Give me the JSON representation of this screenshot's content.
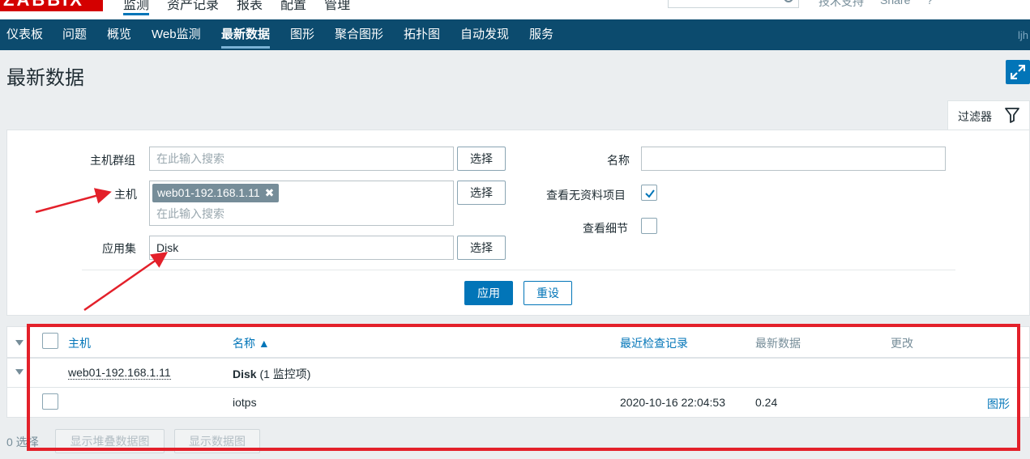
{
  "app": {
    "logo": "ZABBIX"
  },
  "top_nav": [
    "监测",
    "资产记录",
    "报表",
    "配置",
    "管理"
  ],
  "top_right": {
    "support": "技术支持",
    "share": "Share",
    "help": "?"
  },
  "menu": {
    "items": [
      "仪表板",
      "问题",
      "概览",
      "Web监测",
      "最新数据",
      "图形",
      "聚合图形",
      "拓扑图",
      "自动发现",
      "服务"
    ],
    "active": "最新数据",
    "user": "ljh"
  },
  "page": {
    "title": "最新数据"
  },
  "filter": {
    "tab_label": "过滤器",
    "host_group_label": "主机群组",
    "host_group_placeholder": "在此输入搜索",
    "host_label": "主机",
    "host_tag": "web01-192.168.1.11",
    "host_placeholder": "在此输入搜索",
    "application_label": "应用集",
    "application_value": "Disk",
    "select_label": "选择",
    "name_label": "名称",
    "name_value": "",
    "show_no_data_label": "查看无资料项目",
    "show_no_data_checked": true,
    "show_details_label": "查看细节",
    "show_details_checked": false,
    "apply_label": "应用",
    "reset_label": "重设"
  },
  "table": {
    "headers": {
      "host": "主机",
      "name": "名称 ▲",
      "last_check": "最近检查记录",
      "last_value": "最新数据",
      "change": "更改"
    },
    "group": {
      "host": "web01-192.168.1.11",
      "app_name": "Disk",
      "app_count": "(1 监控项)"
    },
    "rows": [
      {
        "name": "iotps",
        "last_check": "2020-10-16 22:04:53",
        "last_value": "0.24",
        "change": "",
        "graph": "图形"
      }
    ]
  },
  "footer": {
    "selected": "0 选择",
    "stacked_graph": "显示堆叠数据图",
    "graph": "显示数据图"
  },
  "colors": {
    "menu_bg": "#0c4b6e",
    "accent": "#0275b8",
    "annotation": "#e3202a"
  }
}
